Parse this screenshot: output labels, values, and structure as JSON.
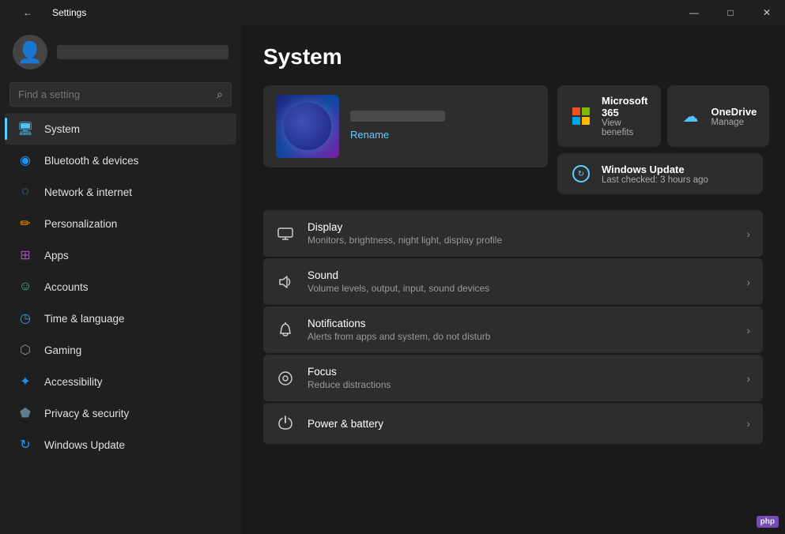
{
  "titlebar": {
    "title": "Settings",
    "back_icon": "←",
    "minimize": "—",
    "maximize": "□",
    "close": "✕"
  },
  "sidebar": {
    "search_placeholder": "Find a setting",
    "search_icon": "🔍",
    "nav_items": [
      {
        "id": "system",
        "label": "System",
        "icon": "🖥",
        "active": true,
        "color": "#4fc3f7"
      },
      {
        "id": "bluetooth",
        "label": "Bluetooth & devices",
        "icon": "🔵",
        "active": false,
        "color": "#2196f3"
      },
      {
        "id": "network",
        "label": "Network & internet",
        "icon": "📶",
        "active": false,
        "color": "#2196f3"
      },
      {
        "id": "personalization",
        "label": "Personalization",
        "icon": "✏️",
        "active": false,
        "color": "#ff9800"
      },
      {
        "id": "apps",
        "label": "Apps",
        "icon": "📦",
        "active": false,
        "color": "#9c27b0",
        "has_arrow": true
      },
      {
        "id": "accounts",
        "label": "Accounts",
        "icon": "👤",
        "active": false,
        "color": "#4caf50"
      },
      {
        "id": "time",
        "label": "Time & language",
        "icon": "🌐",
        "active": false,
        "color": "#2196f3"
      },
      {
        "id": "gaming",
        "label": "Gaming",
        "icon": "🎮",
        "active": false,
        "color": "#9e9e9e"
      },
      {
        "id": "accessibility",
        "label": "Accessibility",
        "icon": "♿",
        "active": false,
        "color": "#2196f3"
      },
      {
        "id": "privacy",
        "label": "Privacy & security",
        "icon": "🛡",
        "active": false,
        "color": "#607d8b"
      },
      {
        "id": "windowsupdate",
        "label": "Windows Update",
        "icon": "🔄",
        "active": false,
        "color": "#2196f3"
      }
    ]
  },
  "content": {
    "page_title": "System",
    "device": {
      "rename_label": "Rename"
    },
    "cards": {
      "microsoft365": {
        "title": "Microsoft 365",
        "subtitle": "View benefits"
      },
      "onedrive": {
        "title": "OneDrive",
        "subtitle": "Manage"
      },
      "windows_update": {
        "title": "Windows Update",
        "subtitle": "Last checked: 3 hours ago"
      }
    },
    "settings_items": [
      {
        "id": "display",
        "title": "Display",
        "subtitle": "Monitors, brightness, night light, display profile",
        "icon": "🖥"
      },
      {
        "id": "sound",
        "title": "Sound",
        "subtitle": "Volume levels, output, input, sound devices",
        "icon": "🔊"
      },
      {
        "id": "notifications",
        "title": "Notifications",
        "subtitle": "Alerts from apps and system, do not disturb",
        "icon": "🔔"
      },
      {
        "id": "focus",
        "title": "Focus",
        "subtitle": "Reduce distractions",
        "icon": "⏱"
      },
      {
        "id": "power",
        "title": "Power & battery",
        "subtitle": "",
        "icon": "🔋"
      }
    ]
  }
}
